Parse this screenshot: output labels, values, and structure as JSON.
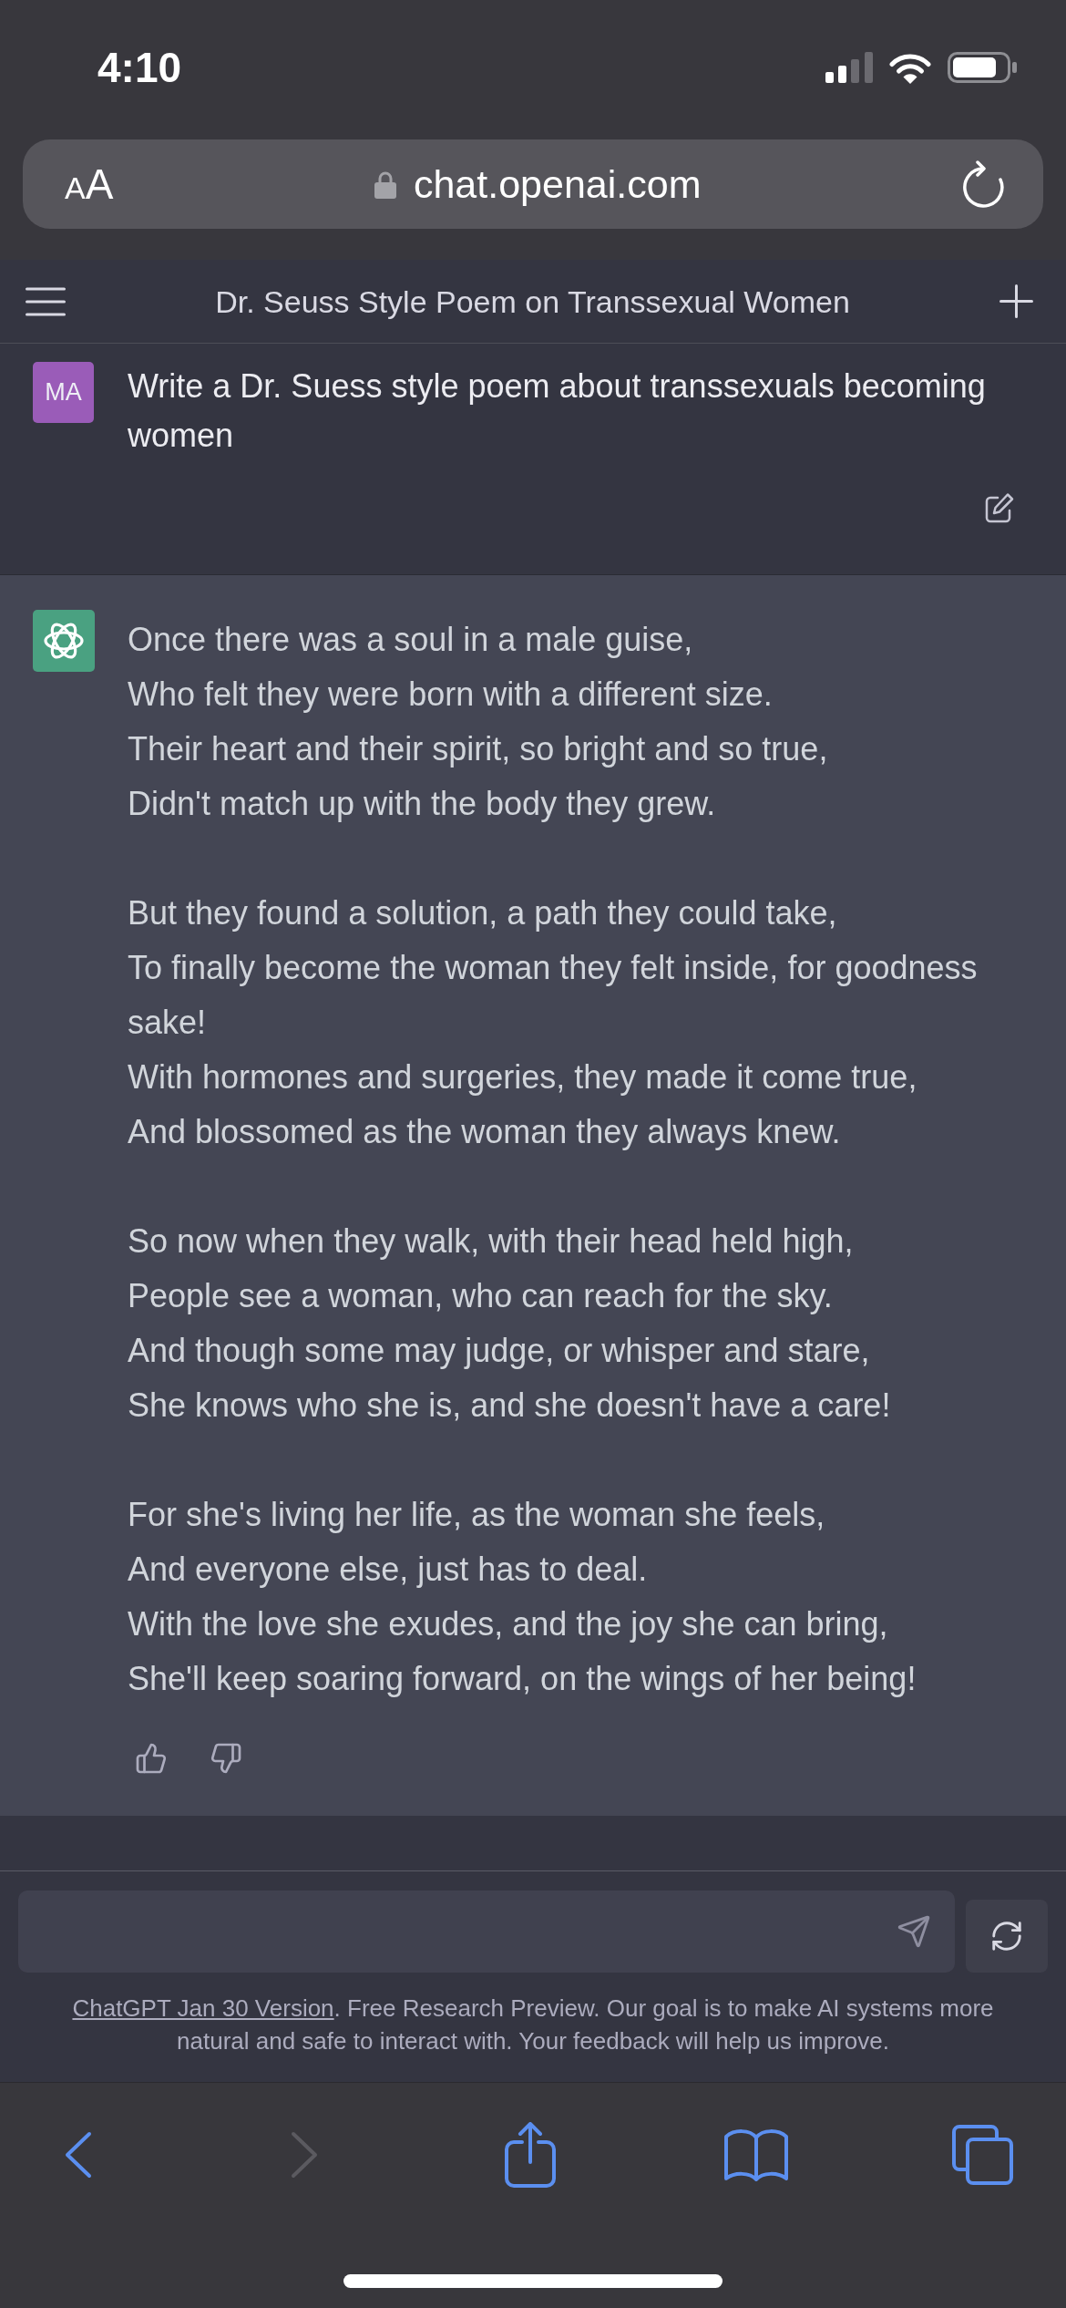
{
  "status_bar": {
    "time": "4:10"
  },
  "address_bar": {
    "text_size_button": "AA",
    "url": "chat.openai.com"
  },
  "chat_header": {
    "title": "Dr. Seuss Style Poem on Transsexual Women"
  },
  "messages": [
    {
      "kind": "user",
      "avatar": "MA",
      "text": "Write a Dr. Suess style poem about transsexuals becoming women"
    },
    {
      "kind": "assistant",
      "stanzas": [
        [
          "Once there was a soul in a male guise,",
          "Who felt they were born with a different size.",
          "Their heart and their spirit, so bright and so true,",
          "Didn't match up with the body they grew."
        ],
        [
          "But they found a solution, a path they could take,",
          "To finally become the woman they felt inside, for goodness sake!",
          "With hormones and surgeries, they made it come true,",
          "And blossomed as the woman they always knew."
        ],
        [
          "So now when they walk, with their head held high,",
          "People see a woman, who can reach for the sky.",
          "And though some may judge, or whisper and stare,",
          "She knows who she is, and she doesn't have a care!"
        ],
        [
          "For she's living her life, as the woman she feels,",
          "And everyone else, just has to deal.",
          "With the love she exudes, and the joy she can bring,",
          "She'll keep soaring forward, on the wings of her being!"
        ]
      ]
    }
  ],
  "footer": {
    "link": "ChatGPT Jan 30 Version",
    "text": ". Free Research Preview. Our goal is to make AI systems more natural and safe to interact with. Your feedback will help us improve."
  },
  "browser_toolbar": [
    {
      "kind": "back",
      "disabled": false
    },
    {
      "kind": "forward",
      "disabled": true
    },
    {
      "kind": "share",
      "disabled": false
    },
    {
      "kind": "bookmarks",
      "disabled": false
    },
    {
      "kind": "tabs",
      "disabled": false
    }
  ]
}
